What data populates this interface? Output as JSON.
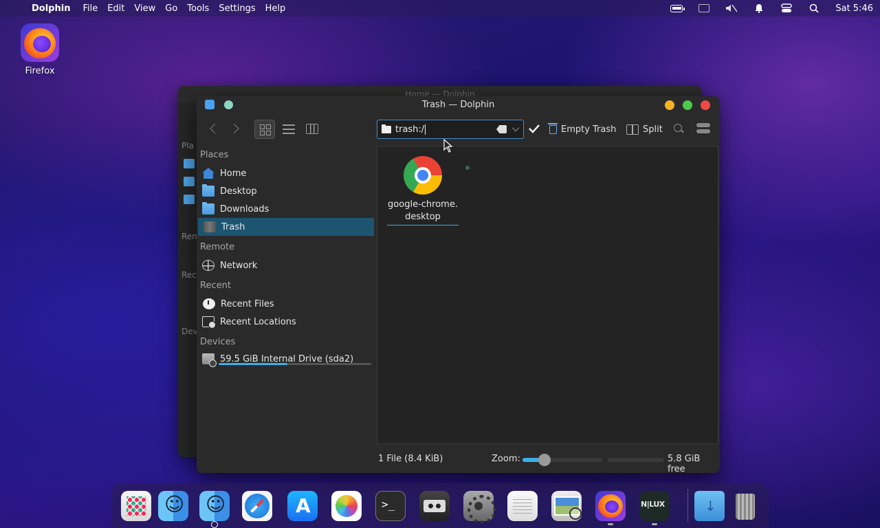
{
  "menubar": {
    "app_name": "Dolphin",
    "items": [
      "File",
      "Edit",
      "View",
      "Go",
      "Tools",
      "Settings",
      "Help"
    ],
    "clock": "Sat 5:46"
  },
  "desktop": {
    "icons": [
      {
        "label": "Firefox",
        "icon": "firefox-icon"
      }
    ]
  },
  "back_window": {
    "title": "Home — Dolphin",
    "sidebar_labels": [
      "Pla",
      "Rem",
      "Rec",
      "Dev"
    ]
  },
  "window": {
    "title": "Trash — Dolphin",
    "location": "trash:/",
    "toolbar": {
      "empty_trash_label": "Empty Trash",
      "split_label": "Split"
    },
    "sidebar": {
      "sections": [
        {
          "title": "Places",
          "items": [
            {
              "label": "Home",
              "icon": "home-icon"
            },
            {
              "label": "Desktop",
              "icon": "folder-icon"
            },
            {
              "label": "Downloads",
              "icon": "folder-icon"
            },
            {
              "label": "Trash",
              "icon": "trash-icon",
              "selected": true
            }
          ]
        },
        {
          "title": "Remote",
          "items": [
            {
              "label": "Network",
              "icon": "globe-icon"
            }
          ]
        },
        {
          "title": "Recent",
          "items": [
            {
              "label": "Recent Files",
              "icon": "clock-icon"
            },
            {
              "label": "Recent Locations",
              "icon": "recent-locations-icon"
            }
          ]
        },
        {
          "title": "Devices",
          "items": [
            {
              "label": "59.5 GiB Internal Drive (sda2)",
              "icon": "drive-icon",
              "usage_fraction": 0.45
            }
          ]
        }
      ]
    },
    "files": [
      {
        "name_line1": "google-chrome.",
        "name_line2": "desktop",
        "icon": "chrome-icon"
      }
    ],
    "status": {
      "summary": "1 File (8.4 KiB)",
      "zoom_label": "Zoom:",
      "zoom_fraction": 0.28,
      "free_space": "5.8 GiB free"
    }
  },
  "dock": {
    "apps": [
      "launchpad-icon",
      "finder-icon",
      "finder-icon",
      "safari-icon",
      "app-store-icon",
      "photos-icon",
      "terminal-icon",
      "cassette-icon",
      "system-settings-icon",
      "textedit-icon",
      "preview-icon",
      "firefox-icon",
      "nilux-icon",
      "downloads-folder-icon",
      "trash-icon"
    ]
  }
}
